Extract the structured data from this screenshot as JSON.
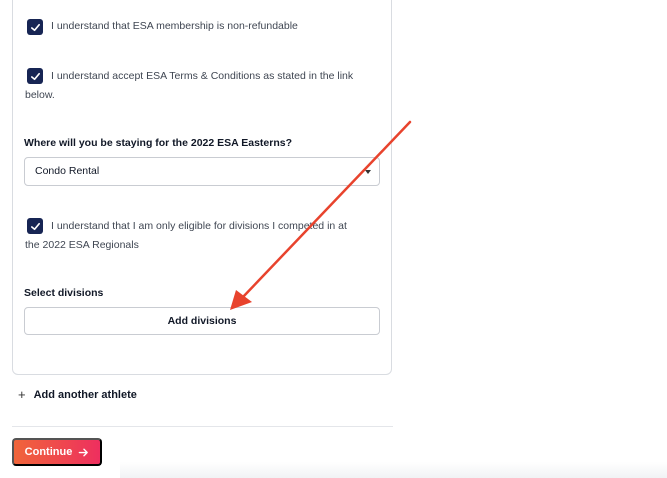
{
  "form": {
    "checkboxes": [
      {
        "label": "I understand that ESA membership is non-refundable",
        "checked": true
      },
      {
        "label_line1": "I understand accept ESA Terms & Conditions as stated in the link",
        "label_line2": "below.",
        "checked": true
      },
      {
        "label_line1": "I understand that I am only eligible for divisions I competed in at",
        "label_line2": "the 2022 ESA Regionals",
        "checked": true
      }
    ],
    "stay_question": "Where will you be staying for the 2022 ESA Easterns?",
    "stay_selected": "Condo Rental",
    "divisions_label": "Select divisions",
    "add_divisions_button": "Add divisions"
  },
  "add_athlete": {
    "icon": "plus-icon",
    "label": "Add another athlete"
  },
  "continue_button": {
    "label": "Continue",
    "icon": "arrow-right-icon"
  },
  "colors": {
    "checkbox": "#172554",
    "continue_gradient_start": "#f0653a",
    "continue_gradient_end": "#ee2f5f",
    "annotation_arrow": "#e8432d"
  }
}
